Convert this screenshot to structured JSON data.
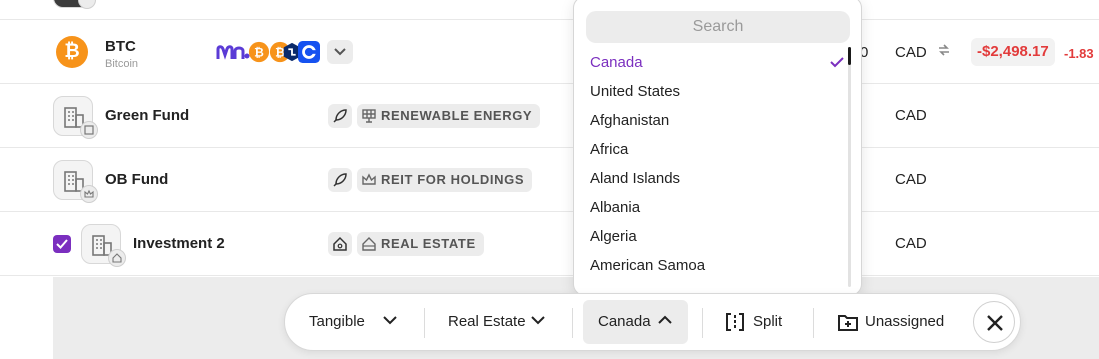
{
  "rows": [
    {
      "symbol": "BTC",
      "name": "Bitcoin",
      "coin_glyph": "₿",
      "exchange_icons": [
        "moonpay-logo-icon",
        "bitcoin-coin-icon",
        "gemini-logo-icon",
        "coinbase-logo-icon"
      ],
      "amount_fragment": "0",
      "currency": "CAD",
      "gain": "-$2,498.17",
      "gain_pct_fragment": "-1.83"
    },
    {
      "name": "Green Fund",
      "tag": "RENEWABLE ENERGY",
      "currency": "CAD"
    },
    {
      "name": "OB Fund",
      "tag": "REIT FOR HOLDINGS",
      "currency": "CAD"
    },
    {
      "name": "Investment 2",
      "tag": "REAL ESTATE",
      "currency": "CAD",
      "checked": true
    }
  ],
  "country_dropdown": {
    "search_placeholder": "Search",
    "options": [
      "Canada",
      "United States",
      "Afghanistan",
      "Africa",
      "Aland Islands",
      "Albania",
      "Algeria",
      "American Samoa"
    ],
    "selected": "Canada"
  },
  "toolbar": {
    "type_label": "Tangible",
    "category_label": "Real Estate",
    "country_label": "Canada",
    "split_label": "Split",
    "unassigned_label": "Unassigned"
  },
  "colors": {
    "accent": "#7b2fbf",
    "negative": "#e23b3b",
    "bitcoin": "#f7931a"
  }
}
